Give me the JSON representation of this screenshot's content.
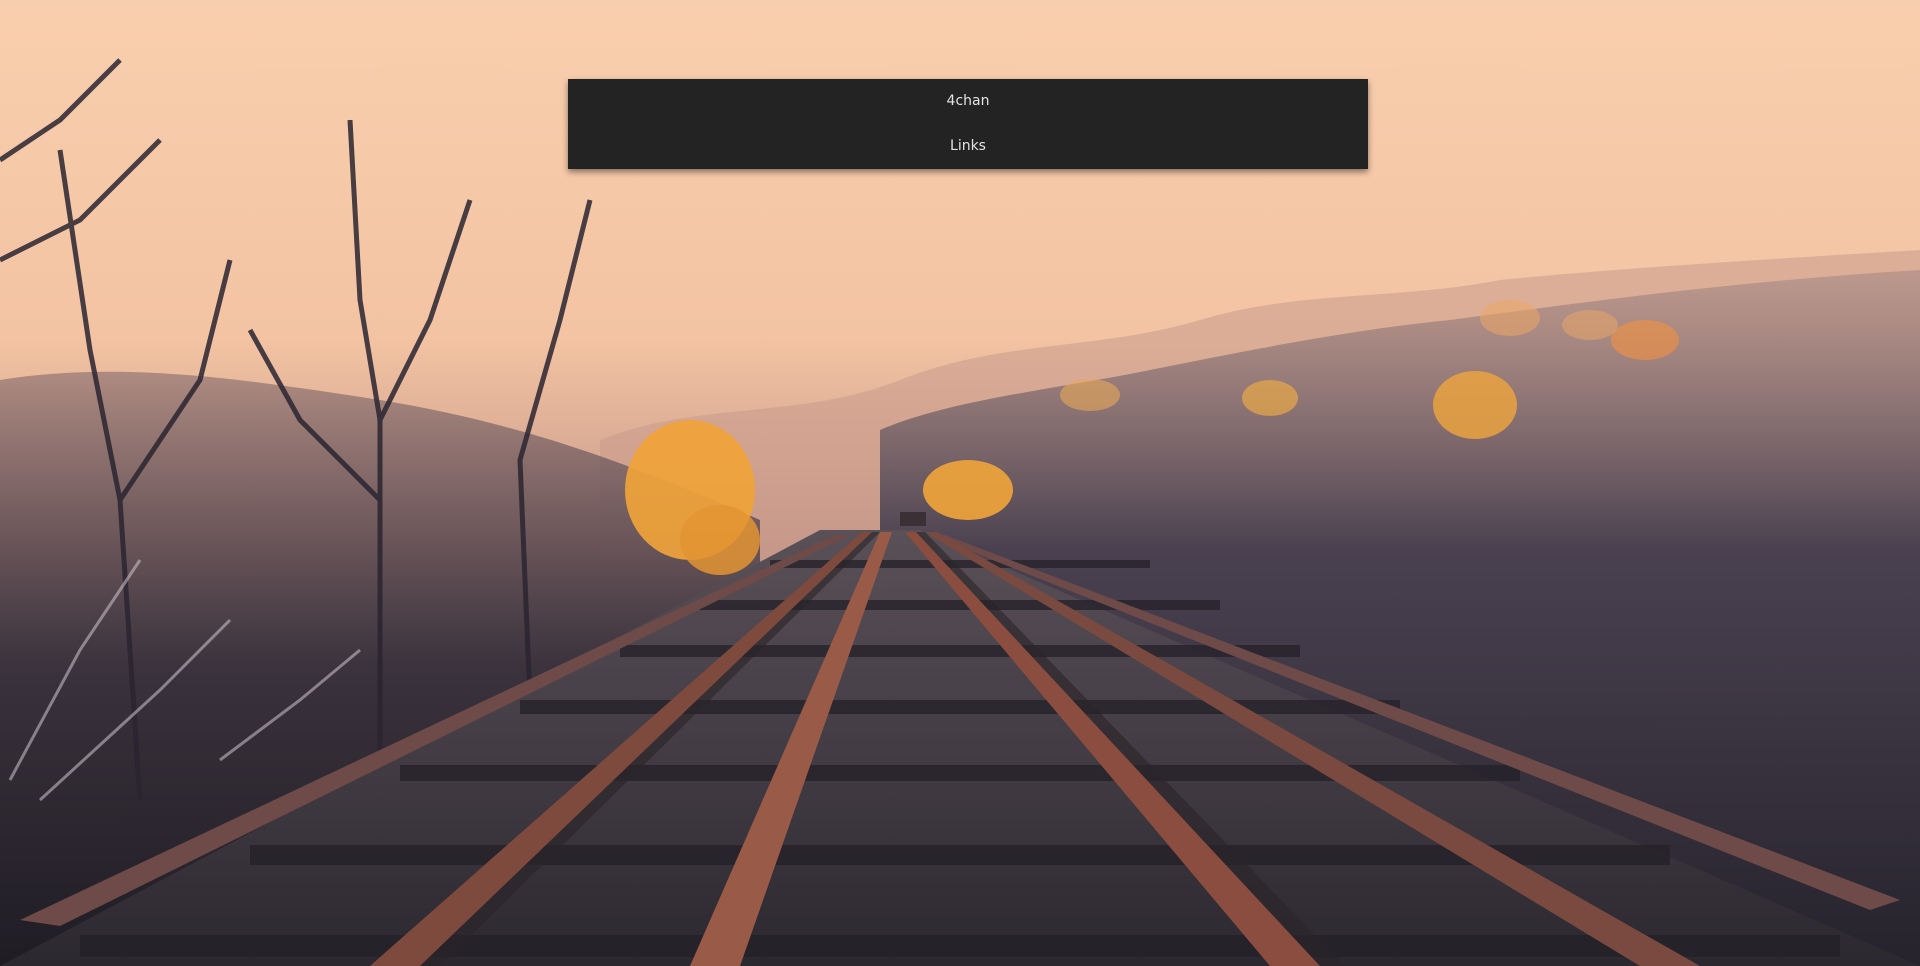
{
  "wallpaper": {
    "subject": "railroad-tracks-foggy-autumn-forest",
    "colors": {
      "sky": "#f5c9a8",
      "fog": "#e7b69b",
      "forest_dark": "#2e2a36",
      "tree_orange": "#f0a33a",
      "rail_rust": "#8a4a3a",
      "sleeper": "#3a3440"
    }
  },
  "menu": {
    "items": [
      {
        "label": "4chan"
      },
      {
        "label": "Links"
      }
    ],
    "colors": {
      "background": "#232324",
      "text": "#e4e4e4"
    }
  }
}
